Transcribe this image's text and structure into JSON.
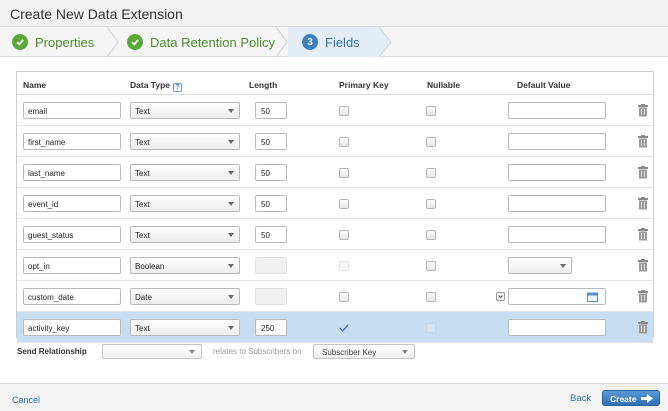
{
  "dialog": {
    "title": "Create New Data Extension"
  },
  "wizard": {
    "steps": [
      {
        "label": "Properties",
        "state": "done"
      },
      {
        "label": "Data Retention Policy",
        "state": "done"
      },
      {
        "label": "Fields",
        "number": "3",
        "state": "active"
      }
    ]
  },
  "columns": {
    "name": "Name",
    "data_type": "Data Type",
    "data_type_help": "?",
    "length": "Length",
    "primary_key": "Primary Key",
    "nullable": "Nullable",
    "default_value": "Default Value"
  },
  "fields": [
    {
      "name": "email",
      "type": "Text",
      "length": "50",
      "primary_key": false,
      "nullable": false
    },
    {
      "name": "first_name",
      "type": "Text",
      "length": "50",
      "primary_key": false,
      "nullable": false
    },
    {
      "name": "last_name",
      "type": "Text",
      "length": "50",
      "primary_key": false,
      "nullable": false
    },
    {
      "name": "event_id",
      "type": "Text",
      "length": "50",
      "primary_key": false,
      "nullable": false
    },
    {
      "name": "guest_status",
      "type": "Text",
      "length": "50",
      "primary_key": false,
      "nullable": false
    },
    {
      "name": "opt_in",
      "type": "Boolean",
      "length": "",
      "primary_key": false,
      "nullable": false
    },
    {
      "name": "custom_date",
      "type": "Date",
      "length": "",
      "primary_key": false,
      "nullable": false
    },
    {
      "name": "activity_key",
      "type": "Text",
      "length": "250",
      "primary_key": true,
      "nullable": false
    }
  ],
  "relationship": {
    "label": "Send Relationship",
    "left_value": "",
    "relates_text": "relates to Subscribers on",
    "right_value": "Subscriber Key"
  },
  "footer": {
    "cancel": "Cancel",
    "back": "Back",
    "create": "Create"
  },
  "colors": {
    "accent": "#3f7fc0",
    "done": "#5aa83a",
    "selected_row": "#c7ddf1"
  }
}
